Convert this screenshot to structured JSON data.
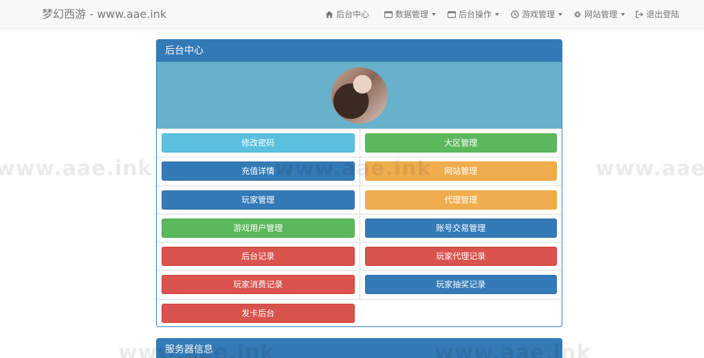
{
  "navbar": {
    "brand": "梦幻西游 - www.aae.ink",
    "items": [
      {
        "label": "后台中心",
        "icon": "home-icon",
        "dropdown": false
      },
      {
        "label": "数据管理",
        "icon": "card-icon",
        "dropdown": true
      },
      {
        "label": "后台操作",
        "icon": "card-icon",
        "dropdown": true
      },
      {
        "label": "游戏管理",
        "icon": "clock-icon",
        "dropdown": true
      },
      {
        "label": "网站管理",
        "icon": "gear-icon",
        "dropdown": true
      },
      {
        "label": "退出登陆",
        "icon": "logout-icon",
        "dropdown": false
      }
    ]
  },
  "watermark": "www.aae.ink",
  "main_panel": {
    "title": "后台中心",
    "buttons": [
      {
        "label": "修改密码",
        "color": "#5bc0de"
      },
      {
        "label": "大区管理",
        "color": "#5cb85c"
      },
      {
        "label": "充值详情",
        "color": "#337ab7"
      },
      {
        "label": "网站管理",
        "color": "#f0ad4e"
      },
      {
        "label": "玩家管理",
        "color": "#337ab7"
      },
      {
        "label": "代理管理",
        "color": "#f0ad4e"
      },
      {
        "label": "游戏用户管理",
        "color": "#5cb85c"
      },
      {
        "label": "账号交易管理",
        "color": "#337ab7"
      },
      {
        "label": "后台记录",
        "color": "#d9534f"
      },
      {
        "label": "玩家代理记录",
        "color": "#d9534f"
      },
      {
        "label": "玩家消费记录",
        "color": "#d9534f"
      },
      {
        "label": "玩家抽奖记录",
        "color": "#337ab7"
      },
      {
        "label": "发卡后台",
        "color": "#d9534f"
      }
    ]
  },
  "server_panel": {
    "title": "服务器信息"
  }
}
